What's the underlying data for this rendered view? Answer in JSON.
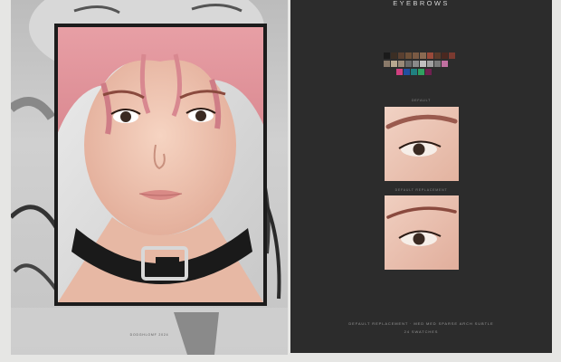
{
  "left_panel": {
    "credit": "DODGHLOMF 2024",
    "background_art_icon": "monochrome-portrait-artwork",
    "portrait_icon": "pink-haired-portrait-with-choker"
  },
  "right_panel": {
    "title": "EYEBROWS",
    "swatches": {
      "row1": [
        "#1a1a1a",
        "#3b2e24",
        "#5a4030",
        "#6e5038",
        "#7a5a44",
        "#8a6a52",
        "#9a4a3a",
        "#5a3a2a",
        "#4a2820",
        "#7a3a30"
      ],
      "row2": [
        "#8a7a6a",
        "#b8a890",
        "#9a8a78",
        "#6a6a6a",
        "#8a8a8a",
        "#c0c0c0",
        "#a0a0a0",
        "#7a7a7a",
        "#c070a0"
      ],
      "row3": [
        "#d04080",
        "#2050a0",
        "#208080",
        "#30a060",
        "#702050"
      ]
    },
    "preview_default": {
      "label": "DEFAULT",
      "image_icon": "eye-closeup-default-brow"
    },
    "preview_replacement": {
      "label": "DEFAULT REPLACEMENT",
      "image_icon": "eye-closeup-replacement-brow"
    },
    "description": "DEFAULT REPLACEMENT · MED MED SPARSE ARCH SUBTLE",
    "count": "24 SWATCHES"
  }
}
